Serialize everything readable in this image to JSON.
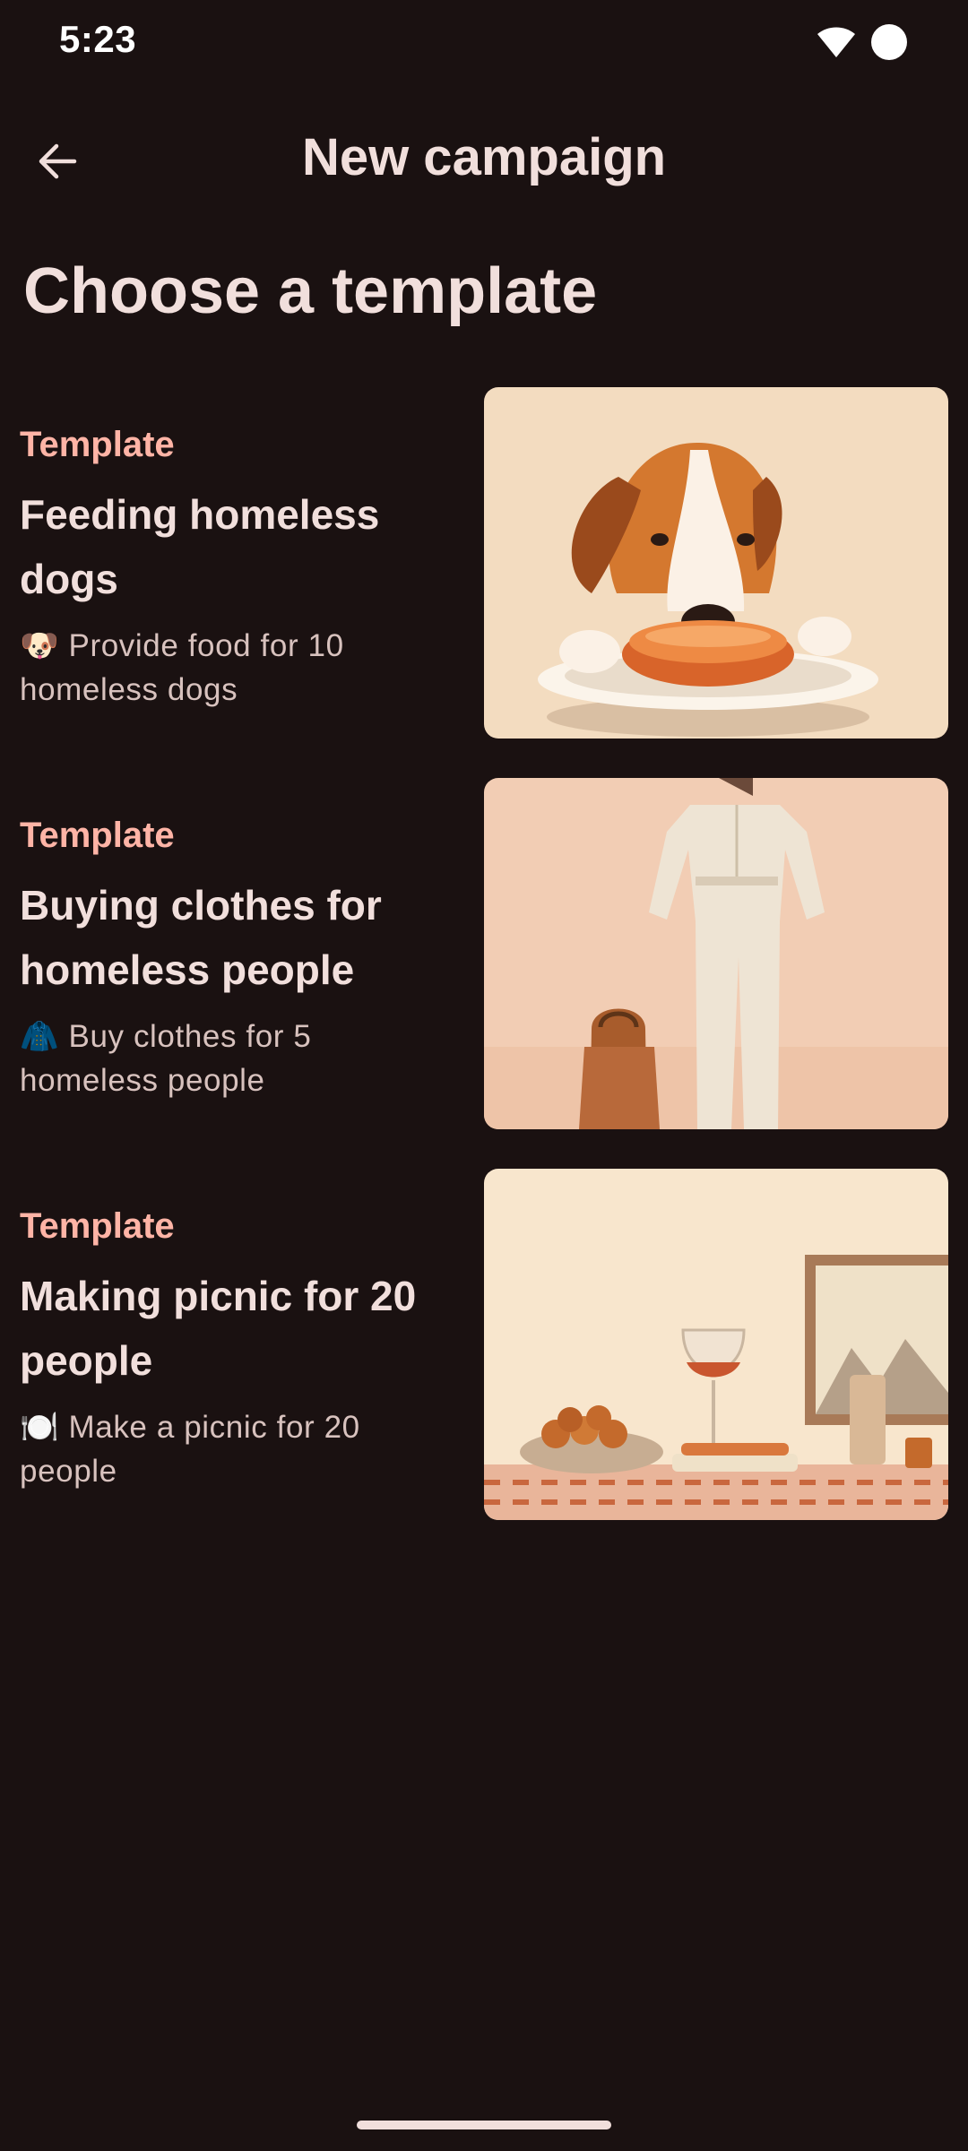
{
  "status_bar": {
    "time": "5:23",
    "icons": [
      "wifi-icon",
      "battery-icon"
    ]
  },
  "app_bar": {
    "back_icon": "arrow-back-icon",
    "title": "New campaign"
  },
  "heading": "Choose a template",
  "templates": [
    {
      "kicker": "Template",
      "title": "Feeding homeless dogs",
      "emoji": "🐶",
      "description": "Provide food for 10 homeless dogs",
      "image": "dog-eating-illustration"
    },
    {
      "kicker": "Template",
      "title": "Buying clothes for homeless people",
      "emoji": "🧥",
      "description": "Buy clothes for 5 homeless people",
      "image": "clothes-illustration"
    },
    {
      "kicker": "Template",
      "title": "Making picnic for 20 people",
      "emoji": "🍽️",
      "description": "Make a picnic for 20 people",
      "image": "picnic-illustration"
    }
  ],
  "colors": {
    "background": "#1a1111",
    "on_surface": "#f1dfdc",
    "accent": "#ffb4a6",
    "on_surface_variant": "#d8c2be"
  }
}
